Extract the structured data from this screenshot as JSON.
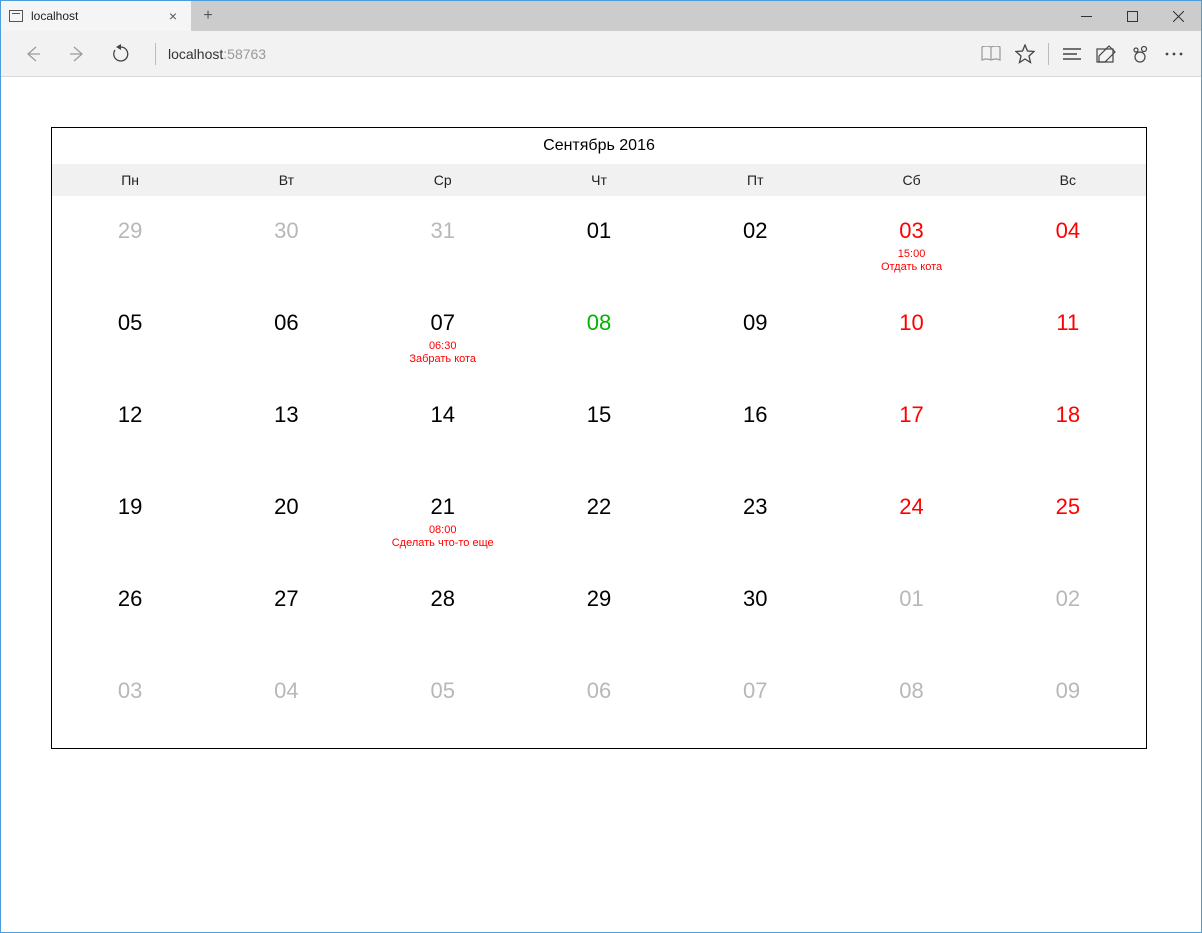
{
  "browser": {
    "tab_title": "localhost",
    "address_host": "localhost",
    "address_port": ":58763"
  },
  "calendar": {
    "title": "Сентябрь 2016",
    "weekdays": [
      "Пн",
      "Вт",
      "Ср",
      "Чт",
      "Пт",
      "Сб",
      "Вс"
    ],
    "weeks": [
      [
        {
          "n": "29",
          "other": true
        },
        {
          "n": "30",
          "other": true
        },
        {
          "n": "31",
          "other": true
        },
        {
          "n": "01"
        },
        {
          "n": "02"
        },
        {
          "n": "03",
          "weekend": true,
          "event": {
            "time": "15:00",
            "text": "Отдать кота"
          }
        },
        {
          "n": "04",
          "weekend": true
        }
      ],
      [
        {
          "n": "05"
        },
        {
          "n": "06"
        },
        {
          "n": "07",
          "event": {
            "time": "06:30",
            "text": "Забрать кота"
          }
        },
        {
          "n": "08",
          "today": true
        },
        {
          "n": "09"
        },
        {
          "n": "10",
          "weekend": true
        },
        {
          "n": "11",
          "weekend": true
        }
      ],
      [
        {
          "n": "12"
        },
        {
          "n": "13"
        },
        {
          "n": "14"
        },
        {
          "n": "15"
        },
        {
          "n": "16"
        },
        {
          "n": "17",
          "weekend": true
        },
        {
          "n": "18",
          "weekend": true
        }
      ],
      [
        {
          "n": "19"
        },
        {
          "n": "20"
        },
        {
          "n": "21",
          "event": {
            "time": "08:00",
            "text": "Сделать что-то еще"
          }
        },
        {
          "n": "22"
        },
        {
          "n": "23"
        },
        {
          "n": "24",
          "weekend": true
        },
        {
          "n": "25",
          "weekend": true
        }
      ],
      [
        {
          "n": "26"
        },
        {
          "n": "27"
        },
        {
          "n": "28"
        },
        {
          "n": "29"
        },
        {
          "n": "30"
        },
        {
          "n": "01",
          "other": true
        },
        {
          "n": "02",
          "other": true
        }
      ],
      [
        {
          "n": "03",
          "other": true
        },
        {
          "n": "04",
          "other": true
        },
        {
          "n": "05",
          "other": true
        },
        {
          "n": "06",
          "other": true
        },
        {
          "n": "07",
          "other": true
        },
        {
          "n": "08",
          "other": true
        },
        {
          "n": "09",
          "other": true
        }
      ]
    ]
  }
}
